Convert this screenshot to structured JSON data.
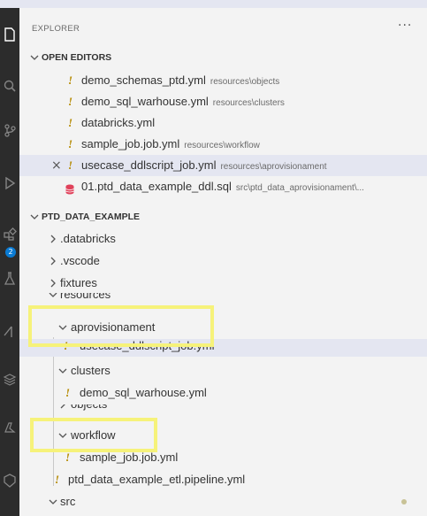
{
  "explorer": {
    "title": "EXPLORER",
    "more": "···"
  },
  "activity_bar": {
    "icons": [
      "files-icon",
      "search-icon",
      "source-control-icon",
      "run-debug-icon",
      "extensions-icon",
      "testing-icon",
      "databricks-icon",
      "stack-icon",
      "azure-icon",
      "account-icon"
    ],
    "badge": "2"
  },
  "open_editors": {
    "title": "OPEN EDITORS",
    "items": [
      {
        "name": "demo_schemas_ptd.yml",
        "path": "resources\\objects"
      },
      {
        "name": "demo_sql_warhouse.yml",
        "path": "resources\\clusters"
      },
      {
        "name": "databricks.yml",
        "path": ""
      },
      {
        "name": "sample_job.job.yml",
        "path": "resources\\workflow"
      },
      {
        "name": "usecase_ddlscript_job.yml",
        "path": "resources\\aprovisionament"
      },
      {
        "name": "01.ptd_data_example_ddl.sql",
        "path": "src\\ptd_data_aprovisionament\\..."
      }
    ]
  },
  "project": {
    "title": "PTD_DATA_EXAMPLE",
    "folders": [
      ".databricks",
      ".vscode",
      "fixtures"
    ],
    "resources": "resources",
    "aprovisionament": "aprovisionament",
    "aprovisionament_file": "usecase_ddlscript_job.yml",
    "clusters": "clusters",
    "clusters_file": "demo_sql_warhouse.yml",
    "objects": "objects",
    "workflow": "workflow",
    "workflow_file": "sample_job.job.yml",
    "pipeline_file": "ptd_data_example_etl.pipeline.yml",
    "src": "src"
  },
  "colors": {
    "highlight": "#f6f27a",
    "selection": "#e4e6f1",
    "yml_icon": "#b58a00",
    "sql_icon": "#e0415a",
    "badge": "#0a7bd4"
  }
}
